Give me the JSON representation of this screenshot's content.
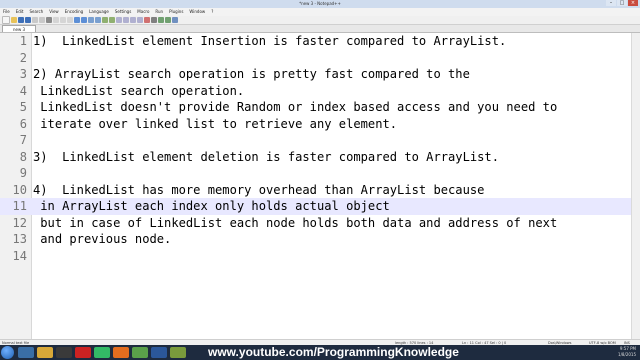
{
  "window": {
    "title": "*new 3 - Notepad++"
  },
  "menu": [
    "File",
    "Edit",
    "Search",
    "View",
    "Encoding",
    "Language",
    "Settings",
    "Macro",
    "Run",
    "Plugins",
    "Window",
    "?"
  ],
  "tab": {
    "label": "new 3"
  },
  "editor": {
    "lines": [
      {
        "n": "1",
        "text": "1)  LinkedList element Insertion is faster compared to ArrayList."
      },
      {
        "n": "2",
        "text": ""
      },
      {
        "n": "3",
        "text": "2) ArrayList search operation is pretty fast compared to the"
      },
      {
        "n": "4",
        "text": " LinkedList search operation."
      },
      {
        "n": "5",
        "text": " LinkedList doesn't provide Random or index based access and you need to"
      },
      {
        "n": "6",
        "text": " iterate over linked list to retrieve any element."
      },
      {
        "n": "7",
        "text": ""
      },
      {
        "n": "8",
        "text": "3)  LinkedList element deletion is faster compared to ArrayList."
      },
      {
        "n": "9",
        "text": ""
      },
      {
        "n": "10",
        "text": "4)  LinkedList has more memory overhead than ArrayList because"
      },
      {
        "n": "11",
        "text": " in ArrayList each index only holds actual object"
      },
      {
        "n": "12",
        "text": " but in case of LinkedList each node holds both data and address of next"
      },
      {
        "n": "13",
        "text": " and previous node."
      },
      {
        "n": "14",
        "text": ""
      }
    ],
    "current_line": "11"
  },
  "status": {
    "type": "Normal text file",
    "length": "length : 570   lines : 14",
    "pos": "Ln : 11   Col : 47   Sel : 0 | 0",
    "eol": "Dos\\Windows",
    "encoding": "UTF-8 w/o BOM",
    "ins": "INS"
  },
  "taskbar": {
    "url": "www.youtube.com/ProgrammingKnowledge",
    "time": "9:57 PM",
    "date": "1/8/2015"
  },
  "colors": {
    "taskbar": "#1e2b3f",
    "current_line": "#e8e8ff"
  }
}
